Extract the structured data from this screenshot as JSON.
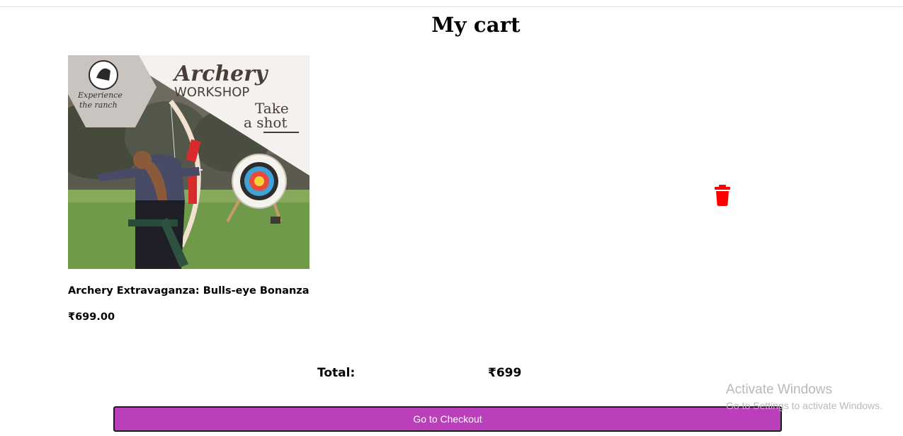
{
  "page": {
    "title": "My cart"
  },
  "cart": {
    "items": [
      {
        "name": "Archery Extravaganza: Bulls-eye Bonanza",
        "price": "₹699.00",
        "image": {
          "badge_line1": "Experience",
          "badge_line2": "the ranch",
          "headline_script": "Archery",
          "headline_caps": "WORKSHOP",
          "tagline_line1": "Take",
          "tagline_line2": "a shot"
        },
        "delete_icon": "trash-icon"
      }
    ],
    "total_label": "Total:",
    "total_value": "₹699",
    "checkout_label": "Go to Checkout"
  },
  "os_watermark": {
    "title": "Activate Windows",
    "subtitle": "Go to Settings to activate Windows."
  },
  "colors": {
    "checkout_bg": "#bb3fbb",
    "delete_icon": "#ff0000",
    "watermark_text": "#b9b9b9"
  }
}
